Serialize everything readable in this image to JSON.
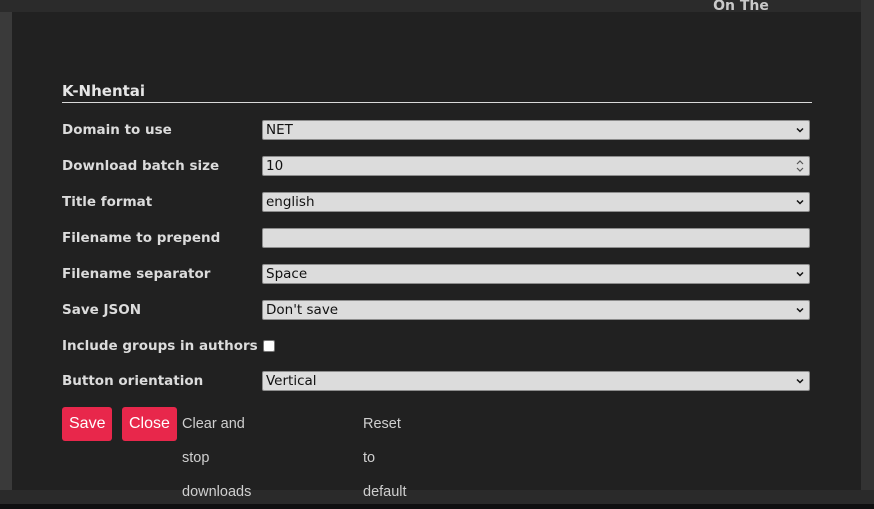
{
  "background": {
    "banner_text": "On The"
  },
  "panel": {
    "title": "K-Nhentai",
    "rows": [
      {
        "label": "Domain to use",
        "type": "select",
        "value": "NET"
      },
      {
        "label": "Download batch size",
        "type": "number",
        "value": "10"
      },
      {
        "label": "Title format",
        "type": "select",
        "value": "english"
      },
      {
        "label": "Filename to prepend",
        "type": "text",
        "value": ""
      },
      {
        "label": "Filename separator",
        "type": "select",
        "value": "Space"
      },
      {
        "label": "Save JSON",
        "type": "select",
        "value": "Don't save"
      },
      {
        "label": "Include groups in authors",
        "type": "checkbox",
        "checked": false
      },
      {
        "label": "Button orientation",
        "type": "select",
        "value": "Vertical"
      }
    ]
  },
  "actions": {
    "save": "Save",
    "close": "Close",
    "clear": "Clear and stop downloads",
    "reset": "Reset to default"
  },
  "colors": {
    "accent": "#e8274b",
    "modal_bg": "#212121"
  }
}
